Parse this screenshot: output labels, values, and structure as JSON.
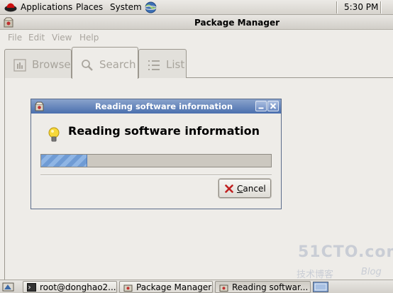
{
  "top_panel": {
    "menus": [
      "Applications",
      "Places",
      "System"
    ],
    "clock": "5:30 PM"
  },
  "main_window": {
    "title": "Package Manager",
    "menu": [
      "File",
      "Edit",
      "View",
      "Help"
    ],
    "tabs": [
      {
        "label": "Browse",
        "icon": "browse-icon"
      },
      {
        "label": "Search",
        "icon": "search-icon"
      },
      {
        "label": "List",
        "icon": "list-icon"
      }
    ]
  },
  "dialog": {
    "title": "Reading software information",
    "heading": "Reading software information",
    "progress_fraction": 0.2,
    "cancel_label": "Cancel",
    "accent_color": "#4a6fae"
  },
  "watermark": {
    "main": "51CTO.com",
    "sub": "技术博客",
    "blog": "Blog"
  },
  "taskbar": {
    "tasks": [
      {
        "label": "root@donghao2...",
        "icon": "terminal-icon"
      },
      {
        "label": "Package Manager",
        "icon": "package-icon"
      },
      {
        "label": "Reading softwar...",
        "icon": "package-icon"
      }
    ]
  }
}
